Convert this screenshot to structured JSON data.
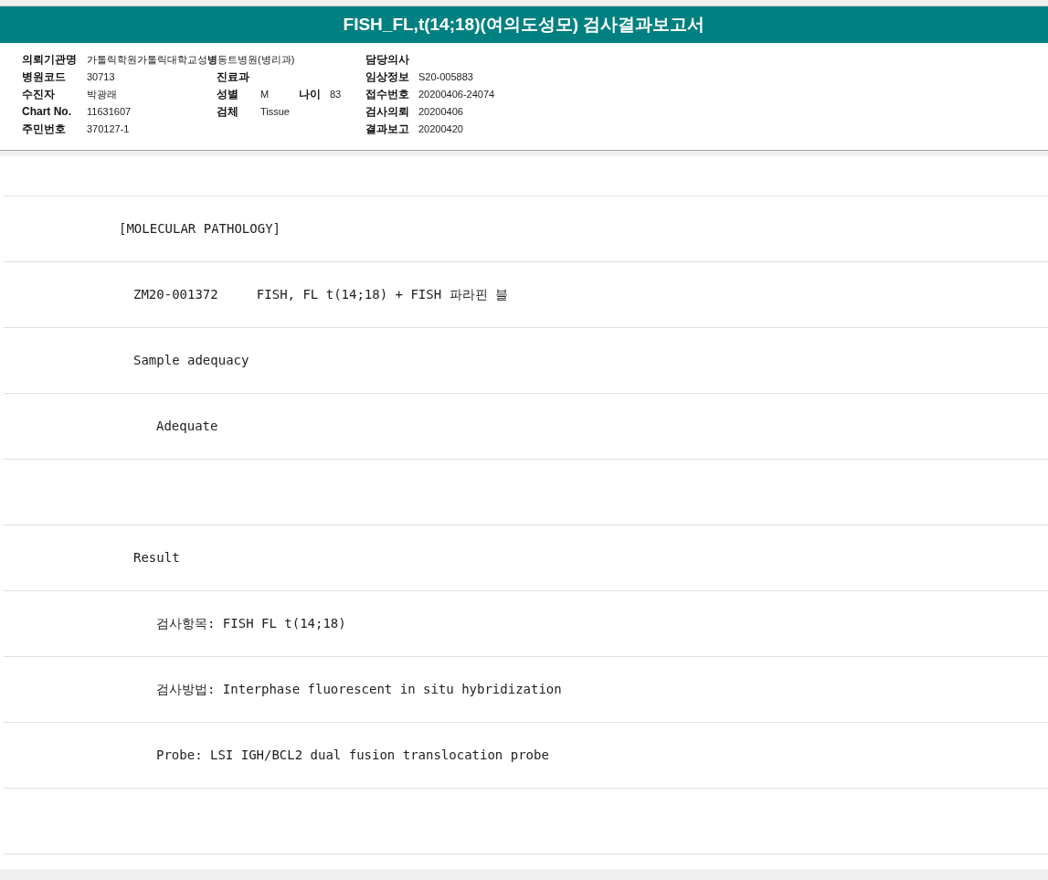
{
  "title": "FISH_FL,t(14;18)(여의도성모) 검사결과보고서",
  "header_rows": [
    {
      "left": {
        "label": "의뢰기관명",
        "value": "가톨릭학원가톨릭대학교성**병**동트병원(병리과)"
      },
      "middle": [],
      "right": {
        "label": "담당의사"
      }
    },
    {
      "left": {
        "label": "병원코드",
        "value": "30713"
      },
      "middle": [
        {
          "label": "진료과"
        }
      ],
      "right": {
        "label": "임상정보",
        "value": "S20-005883"
      }
    },
    {
      "left": {
        "label": "수진자",
        "value": "박광래"
      },
      "middle": [
        {
          "label": "성별",
          "value": "M"
        },
        {
          "label": "나이",
          "value": "83"
        }
      ],
      "right": {
        "label": "접수번호",
        "value": "20200406-24074"
      }
    },
    {
      "left": {
        "label": "Chart No.",
        "value": "11631607"
      },
      "middle": [
        {
          "label": "검체",
          "value": "Tissue"
        }
      ],
      "right": {
        "label": "검사의뢰",
        "value": "20200406"
      }
    },
    {
      "left": {
        "label": "주민번호",
        "value": "370127-1"
      },
      "middle": [],
      "right": {
        "label": "결과보고",
        "value": "20200420"
      }
    }
  ],
  "report_lines": [
    {
      "kind": "heading",
      "text": "[MOLECULAR PATHOLOGY]"
    },
    {
      "kind": "item",
      "text": "ZM20-001372     FISH, FL t(14;18) + FISH 파라핀 블"
    },
    {
      "kind": "item",
      "text": "Sample adequacy"
    },
    {
      "kind": "detail",
      "text": "Adequate"
    },
    {
      "kind": "blank"
    },
    {
      "kind": "item",
      "text": "Result"
    },
    {
      "kind": "detail",
      "text": "검사항목: FISH FL t(14;18)"
    },
    {
      "kind": "detail",
      "text": "검사방법: Interphase fluorescent in situ hybridization"
    },
    {
      "kind": "detail",
      "text": "Probe: LSI IGH/BCL2 dual fusion translocation probe"
    },
    {
      "kind": "blank"
    }
  ]
}
